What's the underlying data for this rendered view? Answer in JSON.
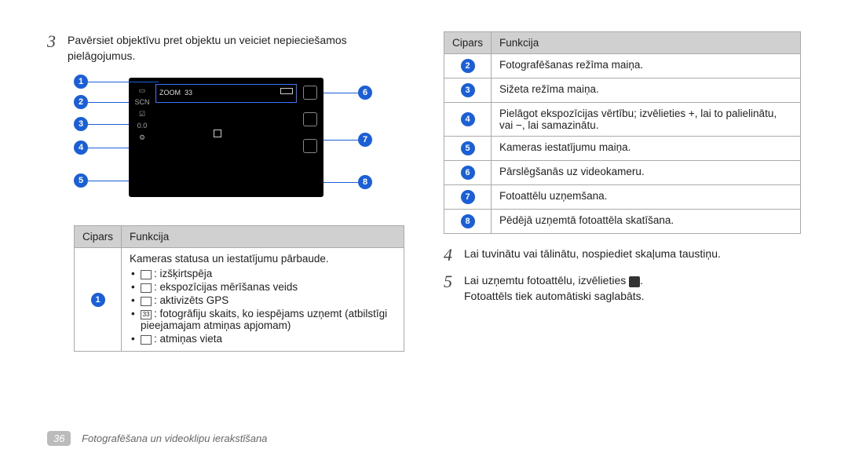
{
  "steps": {
    "s3_num": "3",
    "s3_text": "Pavērsiet objektīvu pret objektu un veiciet nepieciešamos pielāgojumus.",
    "s4_num": "4",
    "s4_text": "Lai tuvinātu vai tālinātu, nospiediet skaļuma taustiņu.",
    "s5_num": "5",
    "s5_text_a": "Lai uzņemtu fotoattēlu, izvēlieties ",
    "s5_text_b": ".",
    "s5_text_c": "Fotoattēls tiek automātiski saglabāts."
  },
  "table_left": {
    "h1": "Cipars",
    "h2": "Funkcija",
    "r1_intro": "Kameras statusa un iestatījumu pārbaude.",
    "b1": ": izšķirtspēja",
    "b2": ": ekspozīcijas mērīšanas veids",
    "b3": ": aktivizēts GPS",
    "b4": ": fotogrāfiju skaits, ko iespējams uzņemt (atbilstīgi pieejamajam atmiņas apjomam)",
    "b5": ": atmiņas vieta"
  },
  "table_right": {
    "h1": "Cipars",
    "h2": "Funkcija",
    "r2": "Fotografēšanas režīma maiņa.",
    "r3": "Sižeta režīma maiņa.",
    "r4": "Pielāgot ekspozīcijas vērtību; izvēlieties +, lai to palielinātu, vai −, lai samazinātu.",
    "r5": "Kameras iestatījumu maiņa.",
    "r6": "Pārslēgšanās uz videokameru.",
    "r7": "Fotoattēlu uzņemšana.",
    "r8": "Pēdējā uzņemtā fotoattēla skatīšana."
  },
  "footer": {
    "page": "36",
    "section": "Fotografēšana un videoklipu ierakstīšana"
  },
  "viewfinder": {
    "scn": "SCN",
    "ev": "0.0",
    "zoom": "ZOOM",
    "count": "33"
  }
}
